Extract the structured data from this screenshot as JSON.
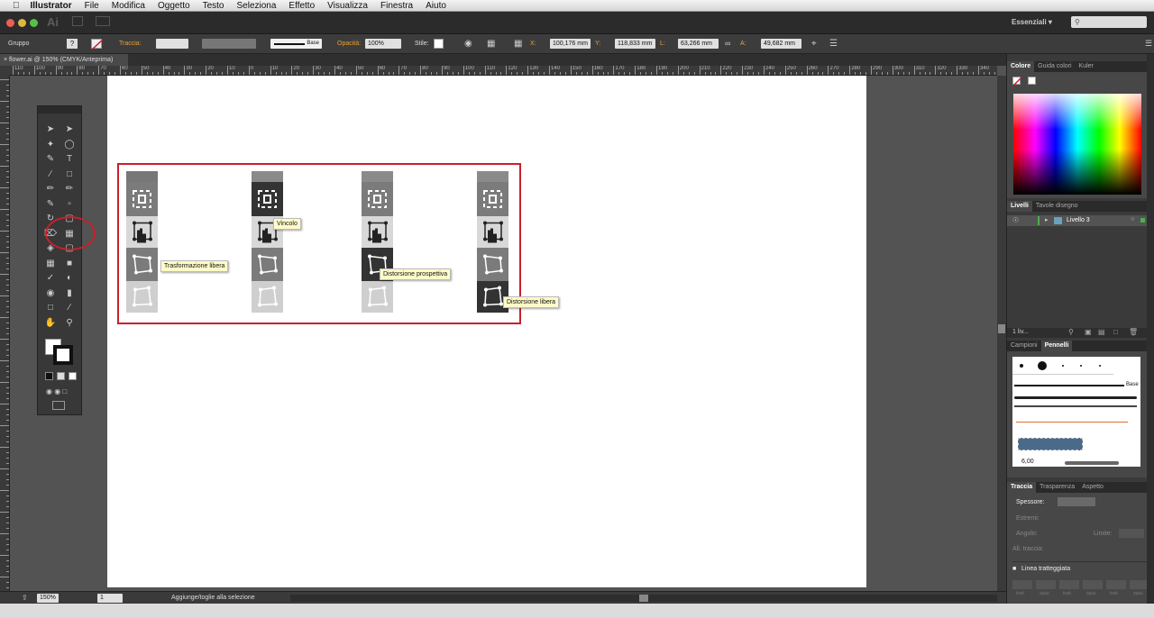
{
  "menubar": {
    "app_name": "Illustrator",
    "items": [
      "File",
      "Modifica",
      "Oggetto",
      "Testo",
      "Seleziona",
      "Effetto",
      "Visualizza",
      "Finestra",
      "Aiuto"
    ]
  },
  "appbar": {
    "logo": "Ai",
    "workspace": "Essenziali ▾",
    "search_icon": "search-icon"
  },
  "control_bar": {
    "selection_type": "Gruppo",
    "stroke_label": "Traccia:",
    "stroke_profile": "Base",
    "opacity_label": "Opacità:",
    "opacity_value": "100%",
    "style_label": "Stile:",
    "x_label": "X:",
    "x_value": "100,176 mm",
    "y_label": "Y:",
    "y_value": "118,833 mm",
    "w_label": "L:",
    "w_value": "63,266 mm",
    "h_label": "A:",
    "h_value": "49,682 mm"
  },
  "document_tab": {
    "title": "flower.ai @ 150% (CMYK/Anteprima)"
  },
  "ruler_labels": [
    "110",
    "100",
    "90",
    "80",
    "70",
    "60",
    "50",
    "40",
    "30",
    "20",
    "10",
    "0",
    "10",
    "20",
    "30",
    "40",
    "50",
    "60",
    "70",
    "80",
    "90",
    "100",
    "110",
    "120",
    "130",
    "140",
    "150",
    "160",
    "170",
    "180",
    "190",
    "200",
    "210",
    "220",
    "230",
    "240",
    "250",
    "260",
    "270",
    "280",
    "290",
    "300",
    "310",
    "320",
    "330",
    "340"
  ],
  "tooltips": {
    "free_transform": "Trasformazione libera",
    "constrain": "Vincolo",
    "perspective": "Distorsione prospettiva",
    "free_distort": "Distorsione libera"
  },
  "status_bar": {
    "zoom": "150%",
    "page": "1",
    "message": "Aggiunge/toglie alla selezione"
  },
  "panels": {
    "color_tabs": [
      "Colore",
      "Guida colori",
      "Kuler"
    ],
    "layers_tabs": [
      "Livelli",
      "Tavole disegno"
    ],
    "layer_name": "Livello 3",
    "layers_count": "1 liv...",
    "swatch_tabs": [
      "Campioni",
      "Pennelli"
    ],
    "brush_base_label": "Base",
    "brush_size": "6,00",
    "stroke_tabs": [
      "Traccia",
      "Trasparenza",
      "Aspetto"
    ],
    "stroke_weight_label": "Spessore:",
    "caps_label": "Estremi:",
    "corner_label": "Angolo:",
    "limit_label": "Limite:",
    "align_label": "All. traccia:",
    "dashed_label": "Linea tratteggiata",
    "dash_labels": [
      "tratt.",
      "spaz.",
      "tratt.",
      "spaz.",
      "tratt.",
      "spaz."
    ]
  },
  "colors": {
    "highlight_red": "#c8202c",
    "tooltip_bg": "#fffbc8"
  }
}
